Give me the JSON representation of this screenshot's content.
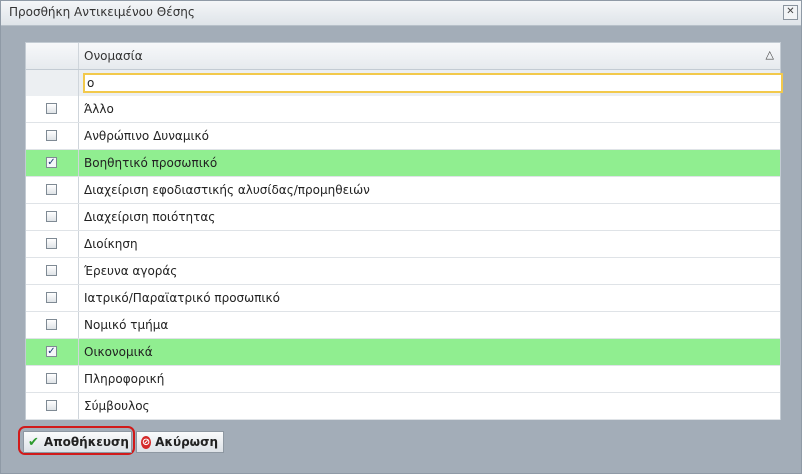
{
  "dialog": {
    "title": "Προσθήκη Αντικειμένου Θέσης",
    "close_icon": "close-icon"
  },
  "grid": {
    "column_header": "Ονομασία",
    "sort_icon": "sort-ascending-icon",
    "filter_value": "ο",
    "rows": [
      {
        "label": "Άλλο",
        "checked": false
      },
      {
        "label": "Ανθρώπινο Δυναμικό",
        "checked": false
      },
      {
        "label": "Βοηθητικό προσωπικό",
        "checked": true
      },
      {
        "label": "Διαχείριση εφοδιαστικής αλυσίδας/προμηθειών",
        "checked": false
      },
      {
        "label": "Διαχείριση ποιότητας",
        "checked": false
      },
      {
        "label": "Διοίκηση",
        "checked": false
      },
      {
        "label": "Έρευνα αγοράς",
        "checked": false
      },
      {
        "label": "Ιατρικό/Παραϊατρικό προσωπικό",
        "checked": false
      },
      {
        "label": "Νομικό τμήμα",
        "checked": false
      },
      {
        "label": "Οικονομικά",
        "checked": true
      },
      {
        "label": "Πληροφορική",
        "checked": false
      },
      {
        "label": "Σύμβουλος",
        "checked": false
      }
    ]
  },
  "footer": {
    "save_label": "Αποθήκευση",
    "cancel_label": "Ακύρωση"
  },
  "colors": {
    "selected_row": "#90ee90",
    "highlight_ring": "#d11a1a"
  }
}
